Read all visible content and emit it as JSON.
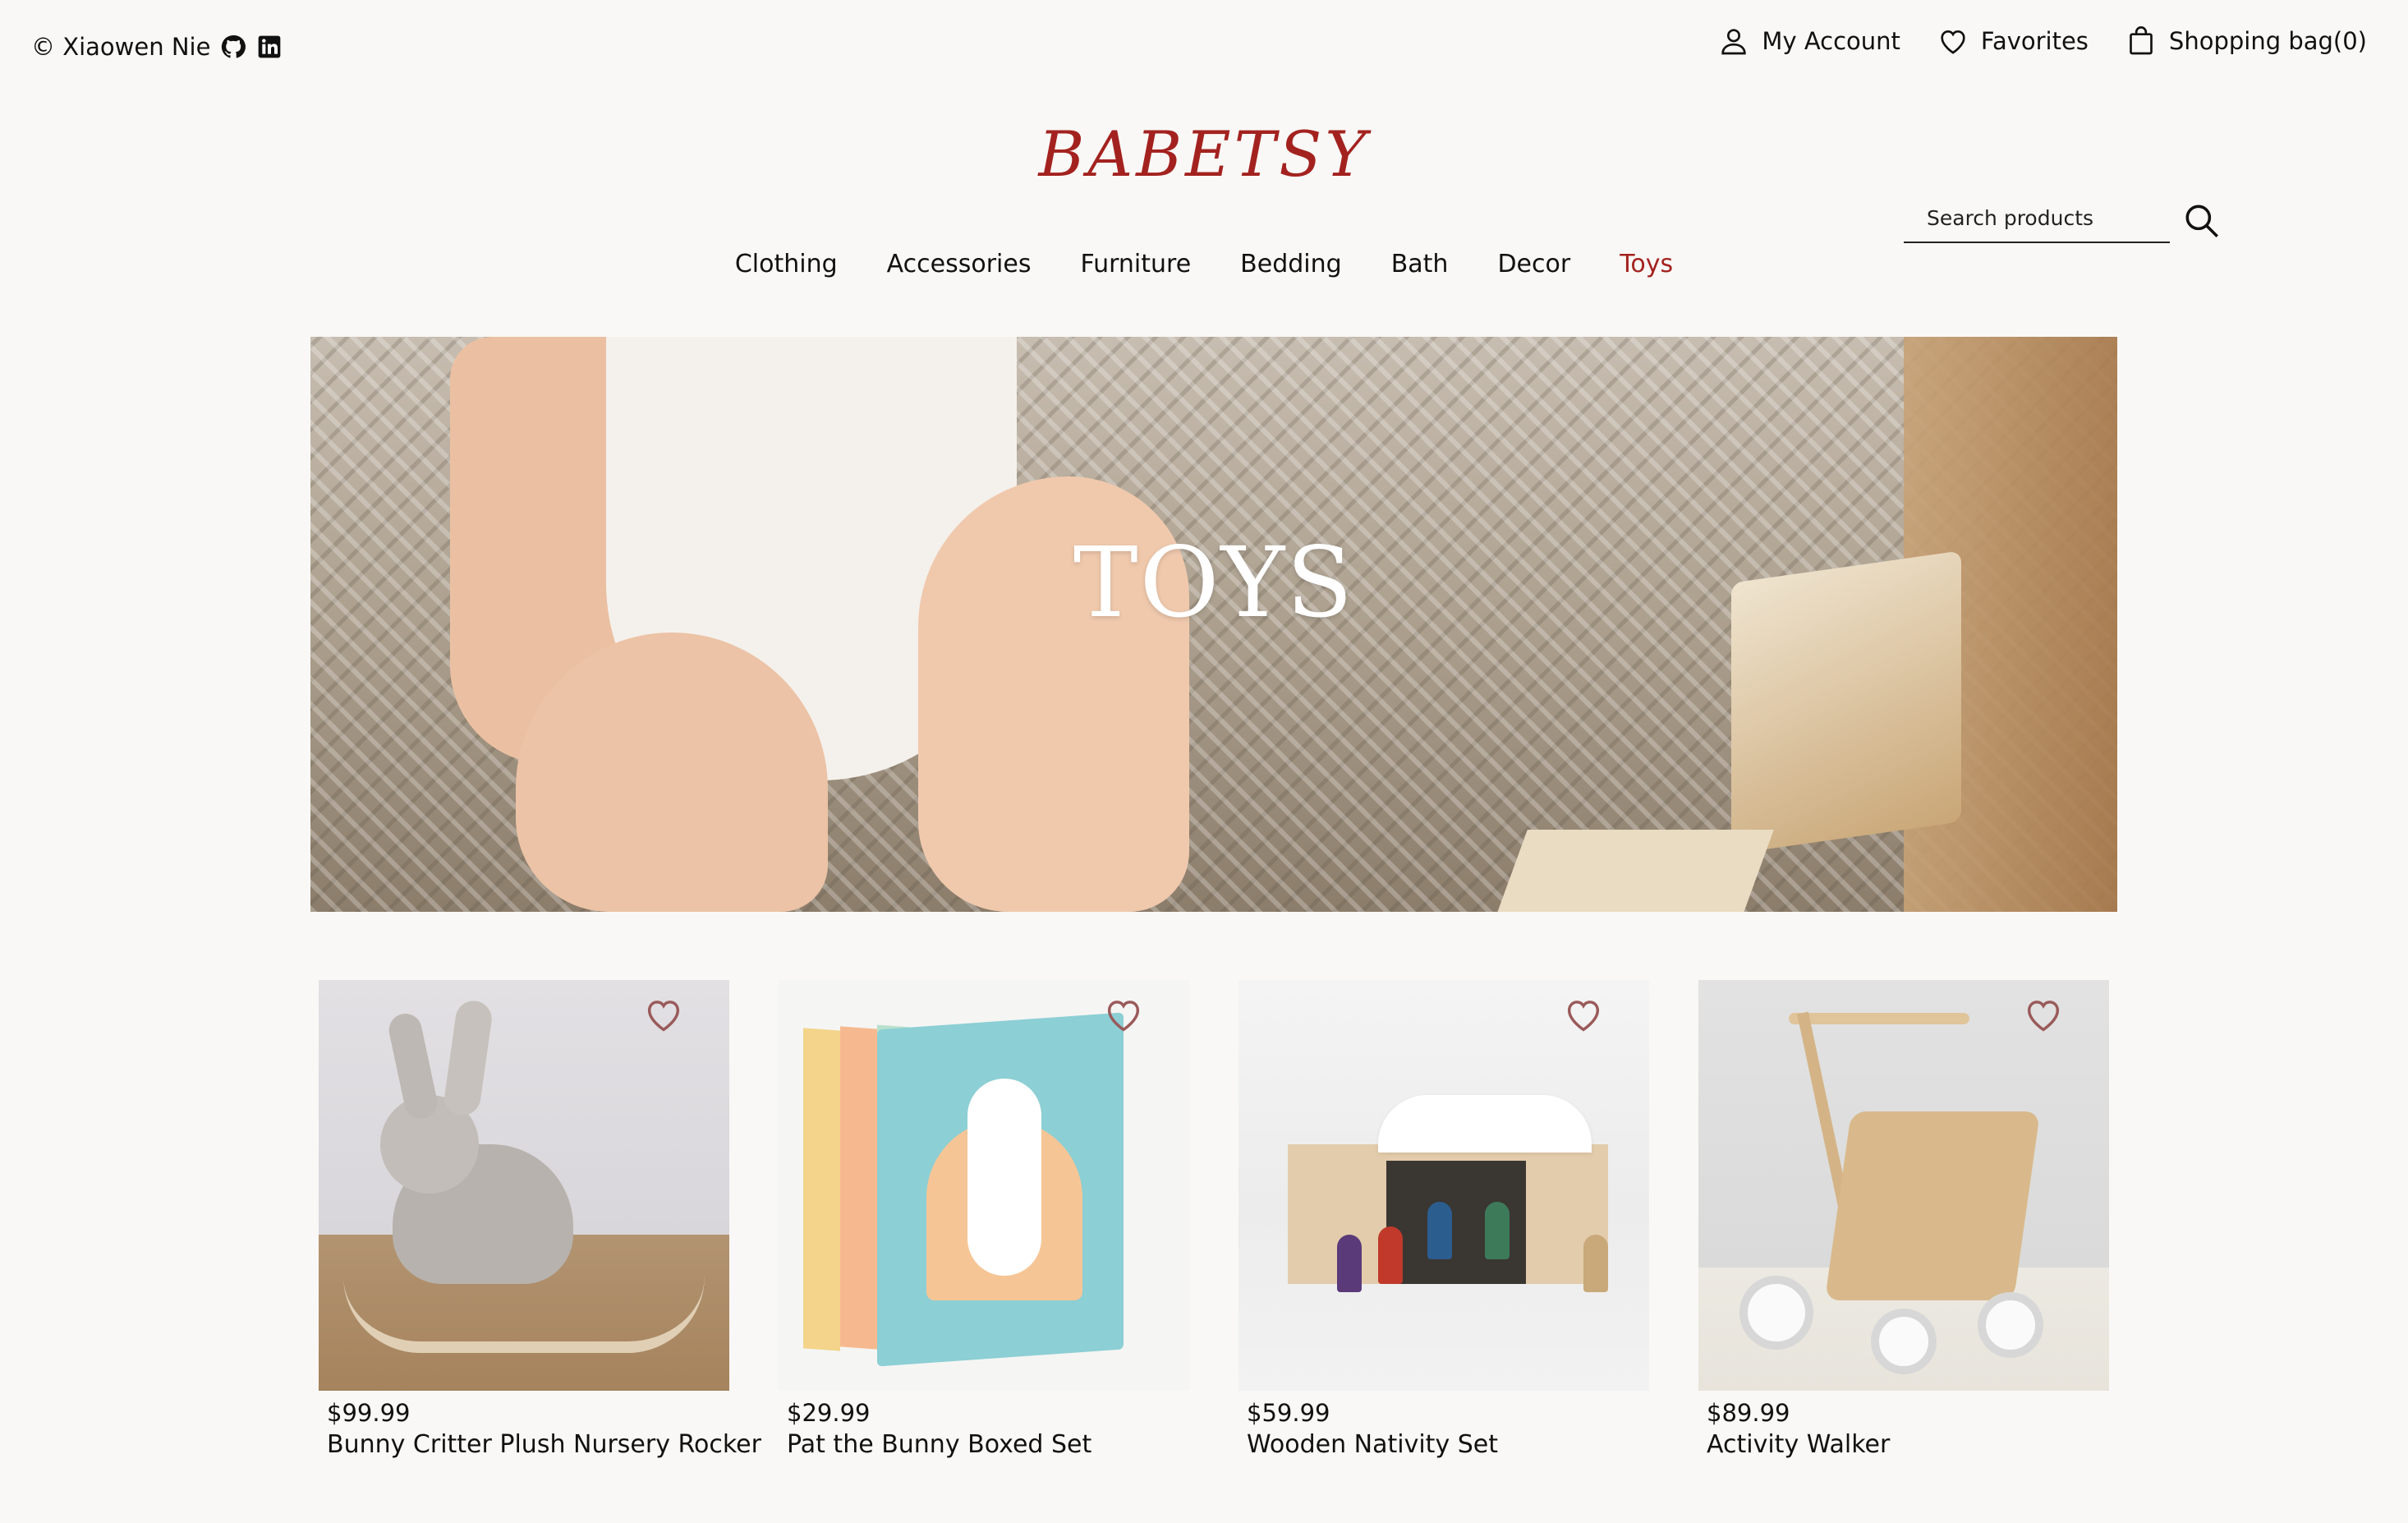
{
  "credit": {
    "text": "© Xiaowen Nie"
  },
  "topnav": {
    "account_label": "My Account",
    "favorites_label": "Favorites",
    "bag_label": "Shopping bag(0)"
  },
  "logo": "BABETSY",
  "search": {
    "placeholder": "Search products",
    "value": ""
  },
  "categories": [
    {
      "label": "Clothing"
    },
    {
      "label": "Accessories"
    },
    {
      "label": "Furniture"
    },
    {
      "label": "Bedding"
    },
    {
      "label": "Bath"
    },
    {
      "label": "Decor"
    },
    {
      "label": "Toys",
      "active": true
    }
  ],
  "hero": {
    "title": "TOYS"
  },
  "products": [
    {
      "price": "$99.99",
      "name": "Bunny Critter Plush Nursery Rocker"
    },
    {
      "price": "$29.99",
      "name": "Pat the Bunny Boxed Set"
    },
    {
      "price": "$59.99",
      "name": "Wooden Nativity Set"
    },
    {
      "price": "$89.99",
      "name": "Activity Walker"
    }
  ],
  "colors": {
    "brand": "#a3221f",
    "background": "#f9f8f6",
    "heart": "#9a5a5a"
  }
}
